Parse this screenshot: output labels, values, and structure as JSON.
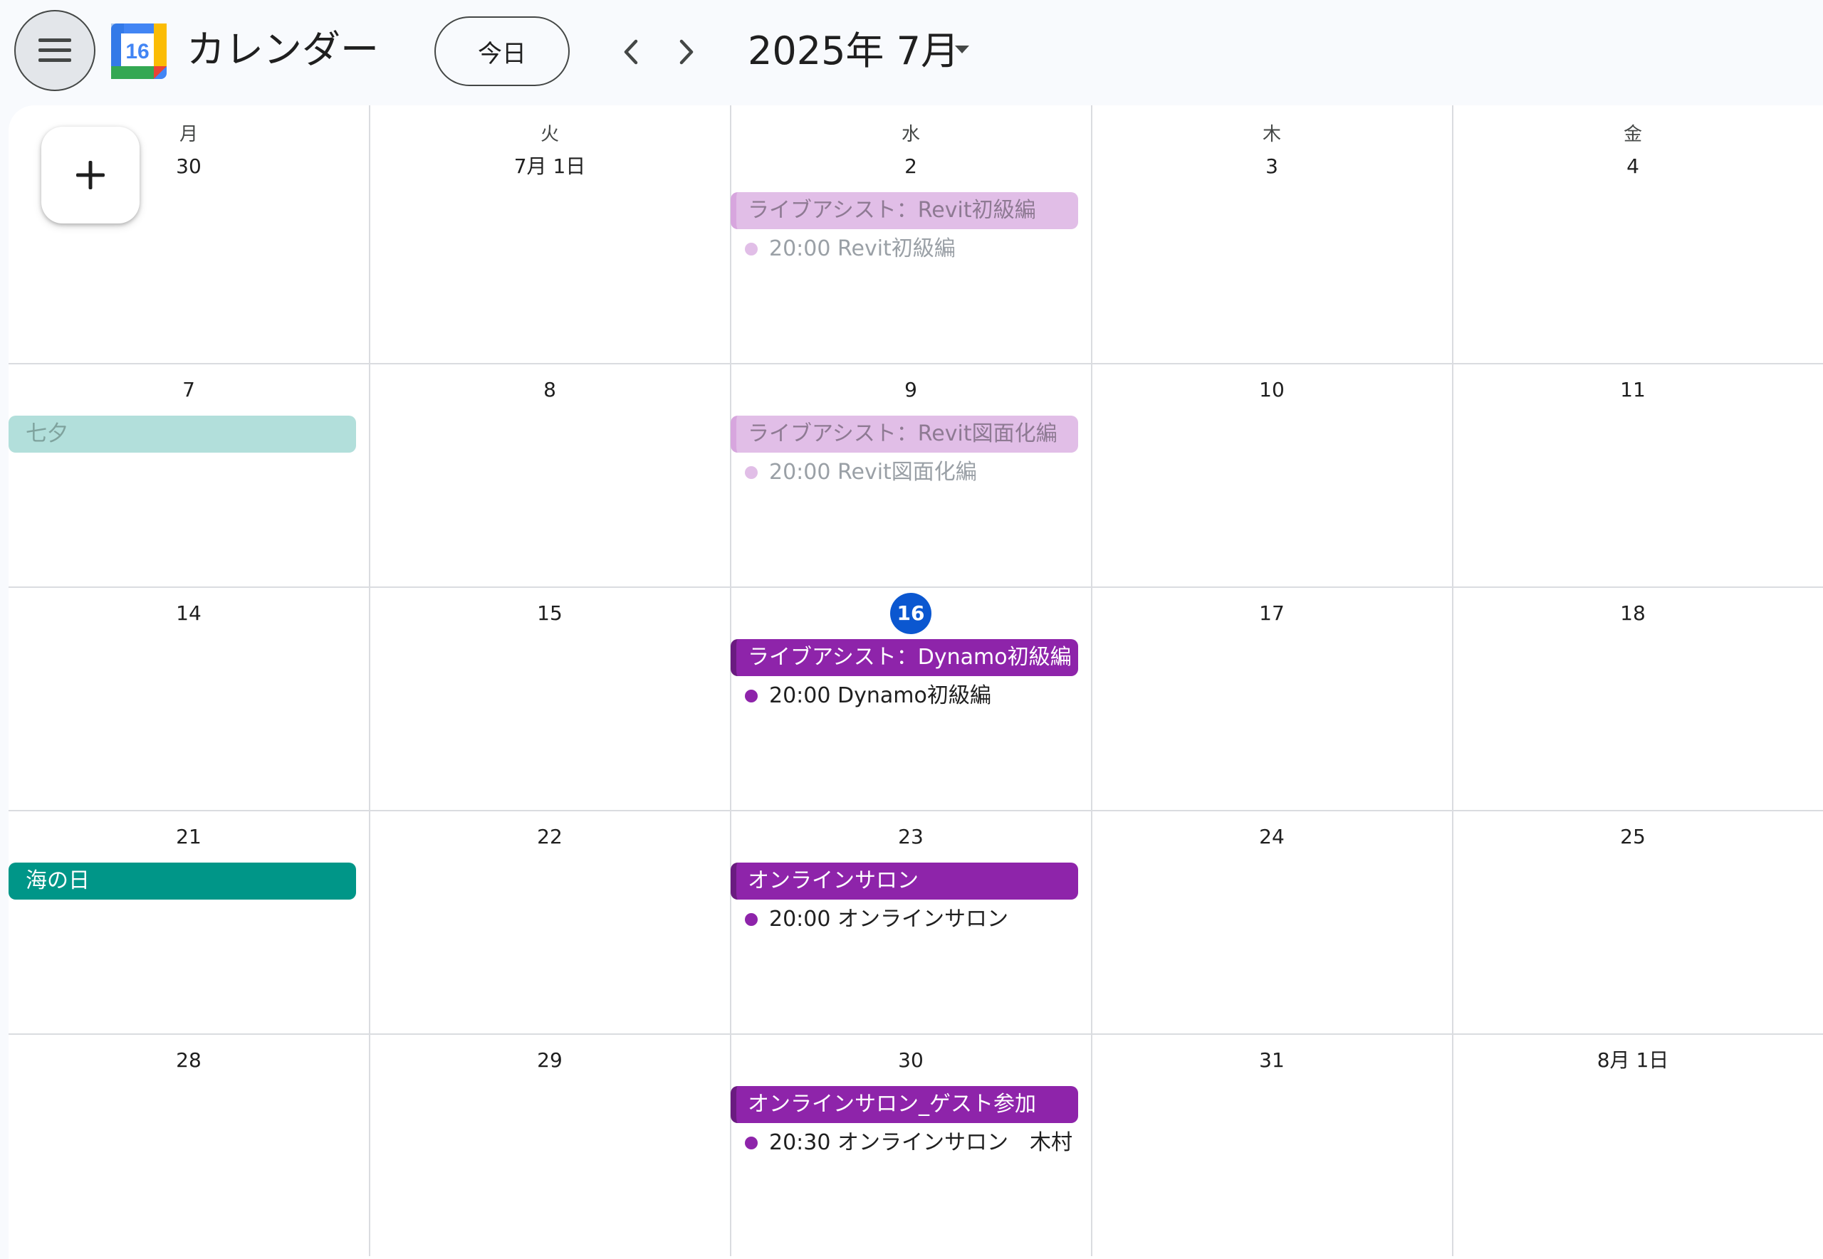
{
  "header": {
    "app_title": "カレンダー",
    "logo_day": "16",
    "today_label": "今日",
    "month_title": "2025年 7月"
  },
  "colors": {
    "accent_blue": "#0b57d0",
    "event_purple": "#8e24aa",
    "event_purple_past": "#e1bee7",
    "holiday_teal": "#009688",
    "holiday_teal_past": "#b2dfdb"
  },
  "calendar": {
    "weekdays": [
      "月",
      "火",
      "水",
      "木",
      "金"
    ],
    "weeks": [
      {
        "days": [
          {
            "label": "30"
          },
          {
            "label": "7月 1日"
          },
          {
            "label": "2",
            "allday": {
              "title": "ライブアシスト：Revit初級編",
              "style": "past-purple"
            },
            "timed": {
              "text": "20:00 Revit初級編",
              "style": "past"
            }
          },
          {
            "label": "3"
          },
          {
            "label": "4"
          }
        ]
      },
      {
        "days": [
          {
            "label": "7",
            "allday": {
              "title": "七夕",
              "style": "past-teal"
            }
          },
          {
            "label": "8"
          },
          {
            "label": "9",
            "allday": {
              "title": "ライブアシスト：Revit図面化編",
              "style": "past-purple"
            },
            "timed": {
              "text": "20:00 Revit図面化編",
              "style": "past"
            }
          },
          {
            "label": "10"
          },
          {
            "label": "11"
          }
        ]
      },
      {
        "days": [
          {
            "label": "14"
          },
          {
            "label": "15"
          },
          {
            "label": "16",
            "today": true,
            "allday": {
              "title": "ライブアシスト：Dynamo初級編",
              "style": "purple"
            },
            "timed": {
              "text": "20:00 Dynamo初級編",
              "style": "now"
            }
          },
          {
            "label": "17"
          },
          {
            "label": "18"
          }
        ]
      },
      {
        "days": [
          {
            "label": "21",
            "allday": {
              "title": "海の日",
              "style": "teal"
            }
          },
          {
            "label": "22"
          },
          {
            "label": "23",
            "allday": {
              "title": "オンラインサロン",
              "style": "purple"
            },
            "timed": {
              "text": "20:00 オンラインサロン",
              "style": "now"
            }
          },
          {
            "label": "24"
          },
          {
            "label": "25"
          }
        ]
      },
      {
        "days": [
          {
            "label": "28"
          },
          {
            "label": "29"
          },
          {
            "label": "30",
            "allday": {
              "title": "オンラインサロン_ゲスト参加",
              "style": "purple"
            },
            "timed": {
              "text": "20:30 オンラインサロン　木村",
              "style": "now"
            }
          },
          {
            "label": "31"
          },
          {
            "label": "8月 1日"
          }
        ]
      }
    ]
  },
  "icons": {
    "menu": "hamburger-menu-icon",
    "prev": "chevron-left-icon",
    "next": "chevron-right-icon",
    "caret": "caret-down-icon",
    "create": "plus-icon"
  }
}
